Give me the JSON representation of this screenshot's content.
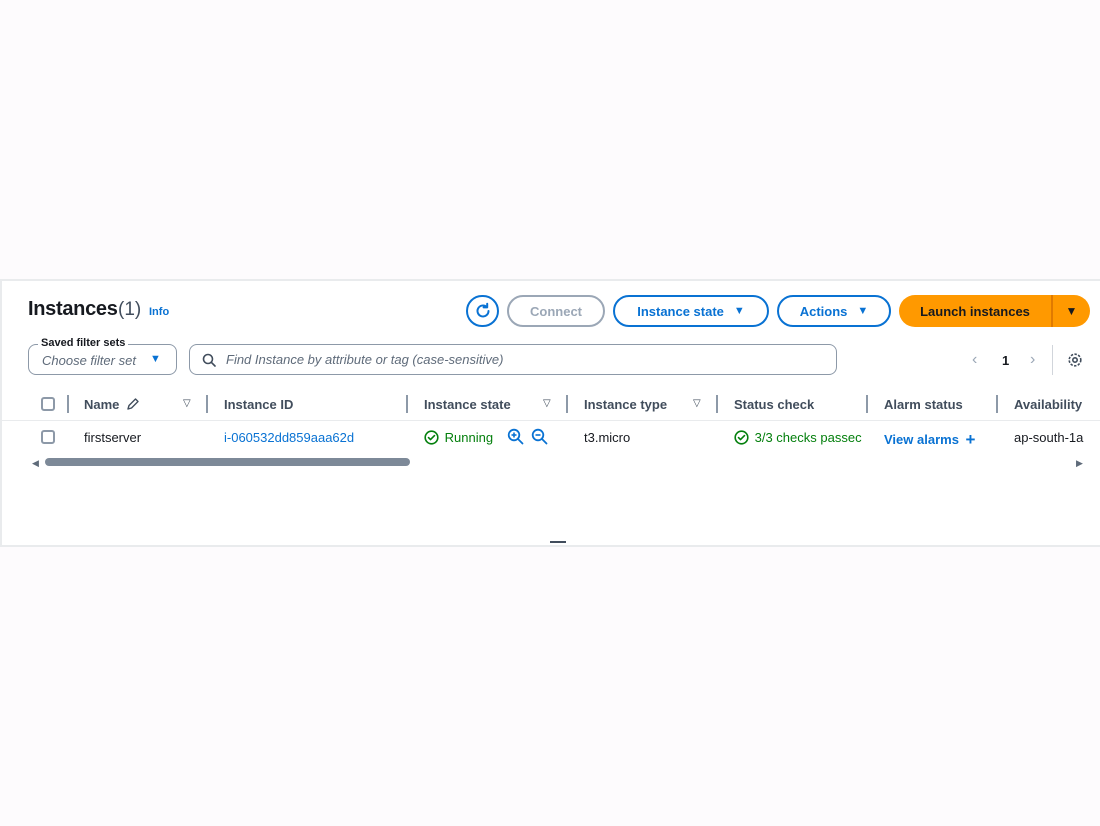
{
  "header": {
    "title": "Instances",
    "count": "(1)",
    "info_link": "Info"
  },
  "toolbar": {
    "refresh_icon": "refresh-icon",
    "connect_label": "Connect",
    "instance_state_label": "Instance state",
    "actions_label": "Actions",
    "launch_label": "Launch instances"
  },
  "filters": {
    "saved_sets_label": "Saved filter sets",
    "saved_sets_value": "Choose filter set",
    "search_placeholder": "Find Instance by attribute or tag (case-sensitive)"
  },
  "pagination": {
    "current_page": "1"
  },
  "table": {
    "columns": [
      "Name",
      "Instance ID",
      "Instance state",
      "Instance type",
      "Status check",
      "Alarm status",
      "Availability"
    ],
    "rows": [
      {
        "name": "firstserver",
        "instance_id": "i-060532dd859aaa62d",
        "instance_state": "Running",
        "instance_type": "t3.micro",
        "status_check": "3/3 checks passec",
        "alarm_status": "View alarms",
        "availability_zone": "ap-south-1a"
      }
    ]
  },
  "colors": {
    "link_blue": "#0972d3",
    "launch_orange": "#ff9900",
    "success_green": "#037f0c"
  }
}
